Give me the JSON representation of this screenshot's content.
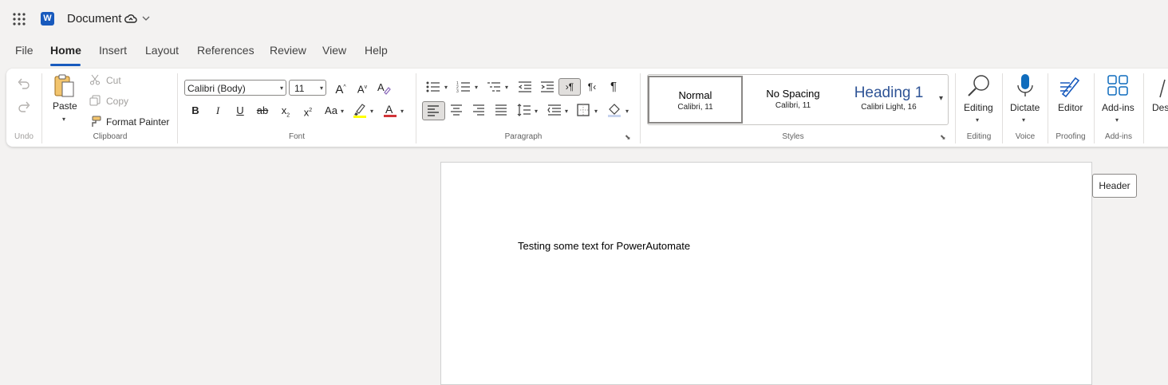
{
  "app": {
    "document_title": "Document",
    "app_icon": "word-logo",
    "logo_letter": "W"
  },
  "tabs": [
    "File",
    "Home",
    "Insert",
    "Layout",
    "References",
    "Review",
    "View",
    "Help"
  ],
  "active_tab": "Home",
  "ribbon": {
    "undo_group": {
      "label": "Undo"
    },
    "clipboard": {
      "label": "Clipboard",
      "paste": "Paste",
      "cut": "Cut",
      "copy": "Copy",
      "format_painter": "Format Painter"
    },
    "font": {
      "label": "Font",
      "font_name": "Calibri (Body)",
      "font_size": "11",
      "bold": "B",
      "italic": "I",
      "underline": "U",
      "strikethrough": "ab",
      "subscript": "x",
      "superscript": "x",
      "change_case": "Aa",
      "font_color_letter": "A",
      "grow_font": "A",
      "shrink_font": "A",
      "highlight_color": "#ffff00",
      "font_color": "#d13438"
    },
    "paragraph": {
      "label": "Paragraph",
      "pilcrow": "¶"
    },
    "styles": {
      "label": "Styles",
      "items": [
        {
          "name": "Normal",
          "font": "Calibri, 11"
        },
        {
          "name": "No Spacing",
          "font": "Calibri, 11"
        },
        {
          "name": "Heading 1",
          "font": "Calibri Light, 16"
        }
      ]
    },
    "editing": {
      "label": "Editing",
      "button": "Editing"
    },
    "voice": {
      "label": "Voice",
      "button": "Dictate"
    },
    "proofing": {
      "label": "Proofing",
      "button": "Editor"
    },
    "addins": {
      "label": "Add-ins",
      "button": "Add-ins"
    },
    "designer": {
      "button": "Des"
    }
  },
  "document": {
    "body_text": "Testing some text for PowerAutomate",
    "header_button": "Header"
  },
  "colors": {
    "accent": "#185abd",
    "heading_blue": "#2f5496",
    "dictate_blue": "#0f6cbd"
  }
}
